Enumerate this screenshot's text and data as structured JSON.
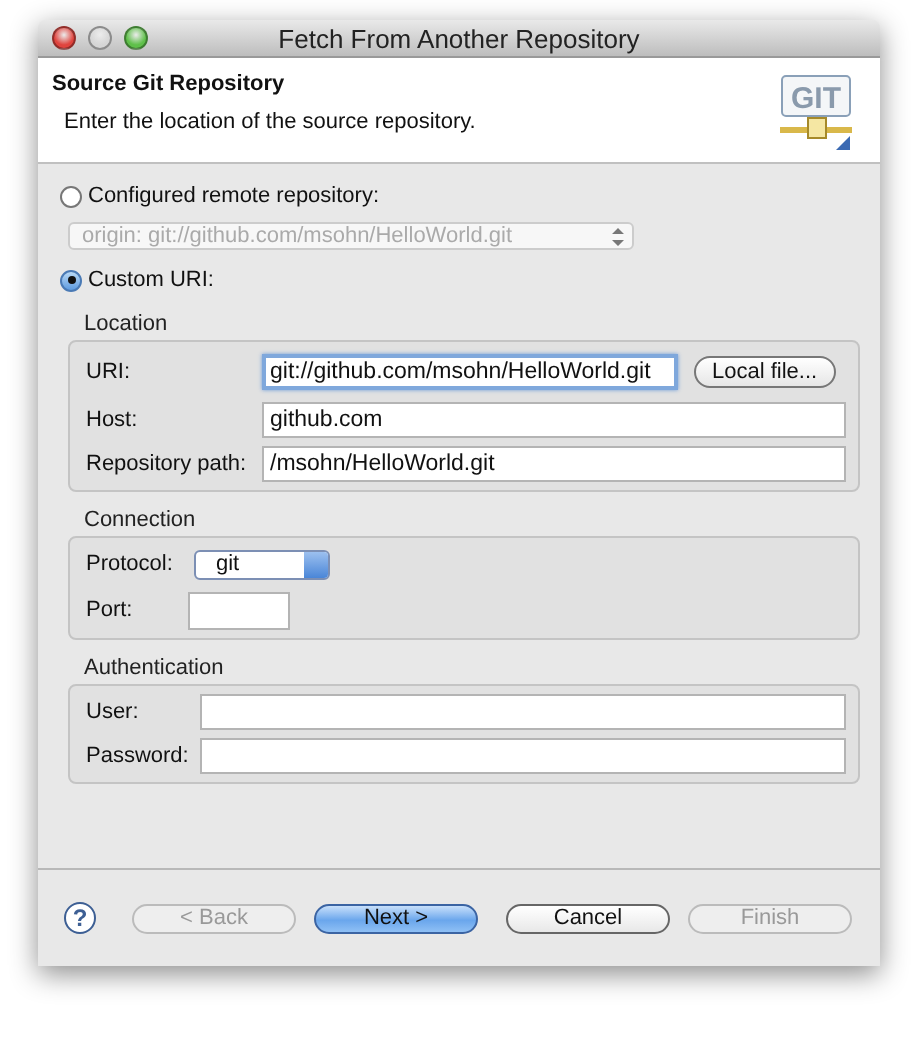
{
  "window": {
    "title": "Fetch From Another Repository"
  },
  "header": {
    "title": "Source Git Repository",
    "description": "Enter the location of the source repository.",
    "logo_text": "GIT"
  },
  "source_options": [
    {
      "label": "Configured remote repository:",
      "selected": false
    },
    {
      "label": "Custom URI:",
      "selected": true
    }
  ],
  "remote_dropdown": {
    "value": "origin: git://github.com/msohn/HelloWorld.git",
    "disabled": true
  },
  "location": {
    "title": "Location",
    "local_file_button": "Local file...",
    "fields": [
      {
        "label": "URI:",
        "value": "git://github.com/msohn/HelloWorld.git",
        "focused": true
      },
      {
        "label": "Host:",
        "value": "github.com",
        "focused": false
      },
      {
        "label": "Repository path:",
        "value": "/msohn/HelloWorld.git",
        "focused": false
      }
    ]
  },
  "connection": {
    "title": "Connection",
    "protocol": {
      "label": "Protocol:",
      "value": "git"
    },
    "port": {
      "label": "Port:"
    }
  },
  "authentication": {
    "title": "Authentication",
    "fields": [
      {
        "label": "User:"
      },
      {
        "label": "Password:"
      }
    ]
  },
  "help_button": "?",
  "buttons": [
    {
      "label": "< Back",
      "disabled": true,
      "default": false
    },
    {
      "label": "Next >",
      "disabled": false,
      "default": true
    },
    {
      "label": "Cancel",
      "disabled": false,
      "default": false
    },
    {
      "label": "Finish",
      "disabled": true,
      "default": false
    }
  ]
}
